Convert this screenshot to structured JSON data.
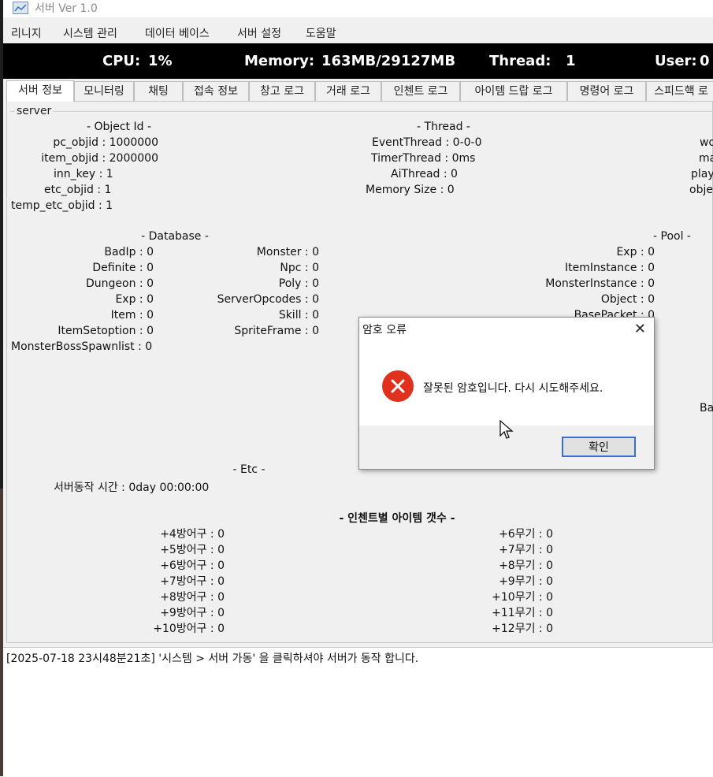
{
  "window": {
    "title": "서버  Ver 1.0"
  },
  "menu": [
    "리니지",
    "시스템 관리",
    "데이터 베이스",
    "서버 설정",
    "도움말"
  ],
  "status": {
    "cpu_label": "CPU:",
    "cpu_value": "1%",
    "memory_label": "Memory:",
    "memory_value": "163MB/29127MB",
    "thread_label": "Thread:",
    "thread_value": "1",
    "user_label": "User:",
    "user_value": "0"
  },
  "tabs": [
    "서버 정보",
    "모니터링",
    "채팅",
    "접속 정보",
    "창고 로그",
    "거래 로그",
    "인첸트 로그",
    "아이템 드랍 로그",
    "명령어 로그",
    "스피드핵 로"
  ],
  "group_label": "server",
  "object_id": {
    "header": "- Object Id -",
    "rows": [
      {
        "label": "pc_objid : 1000000"
      },
      {
        "label": "item_objid : 2000000"
      },
      {
        "label": "inn_key : 1"
      },
      {
        "label": "etc_objid : 1"
      },
      {
        "label": "temp_etc_objid : 1"
      }
    ]
  },
  "thread": {
    "header": "- Thread -",
    "rows": [
      "EventThread : 0-0-0",
      "TimerThread : 0ms",
      "AiThread : 0",
      "Memory Size : 0"
    ]
  },
  "right_clipped": [
    "wo",
    "ma",
    "play",
    "obje"
  ],
  "database": {
    "header": "- Database -",
    "col1": [
      "BadIp : 0",
      "Definite : 0",
      "Dungeon : 0",
      "Exp : 0",
      "Item : 0",
      "ItemSetoption : 0",
      "MonsterBossSpawnlist : 0"
    ],
    "col2": [
      "Monster : 0",
      "Npc : 0",
      "Poly : 0",
      "ServerOpcodes : 0",
      "Skill : 0",
      "SpriteFrame : 0"
    ]
  },
  "pool": {
    "header": "- Pool -",
    "rows": [
      "Exp : 0",
      "ItemInstance : 0",
      "MonsterInstance : 0",
      "Object : 0",
      "BasePacket : 0"
    ],
    "clipped_right": "Ba"
  },
  "etc": {
    "header": "- Etc -",
    "uptime": "서버동작 시간 : 0day 00:00:00"
  },
  "enchant": {
    "header": "- 인첸트별 아이템 갯수 -",
    "armor": [
      "+4방어구 : 0",
      "+5방어구 : 0",
      "+6방어구 : 0",
      "+7방어구 : 0",
      "+8방어구 : 0",
      "+9방어구 : 0",
      "+10방어구 : 0"
    ],
    "weapon": [
      "+6무기 : 0",
      "+7무기 : 0",
      "+8무기 : 0",
      "+9무기 : 0",
      "+10무기 : 0",
      "+11무기 : 0",
      "+12무기 : 0"
    ]
  },
  "log": {
    "line": "[2025-07-18 23시48분21초] '시스템 > 서버 가동' 을 클릭하셔야 서버가 동작 합니다."
  },
  "dialog": {
    "title": "암호 오류",
    "message": "잘못된 암호입니다. 다시 시도해주세요.",
    "ok_label": "확인",
    "icon": "error-icon",
    "close_glyph": "✕"
  },
  "colors": {
    "status_bg": "#000000",
    "error_red": "#e0301e",
    "button_focus": "#3a6fd0"
  }
}
